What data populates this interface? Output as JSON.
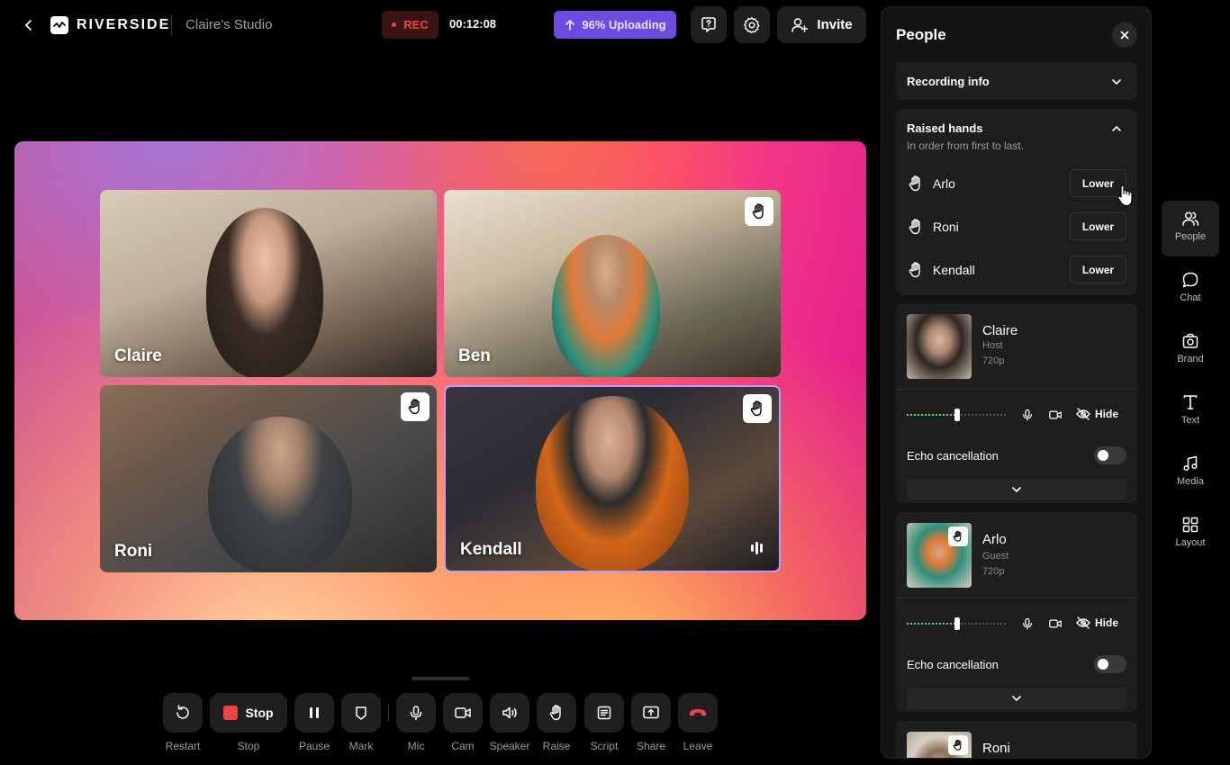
{
  "header": {
    "brand": "RIVERSIDE",
    "studio_name": "Claire’s Studio",
    "rec_label": "REC",
    "timer": "00:12:08",
    "upload_label": "96% Uploading",
    "invite_label": "Invite"
  },
  "stage": {
    "tiles": [
      {
        "name": "Claire",
        "hand_raised": false
      },
      {
        "name": "Ben",
        "hand_raised": true
      },
      {
        "name": "Roni",
        "hand_raised": true
      },
      {
        "name": "Kendall",
        "hand_raised": true,
        "speaking": true
      }
    ]
  },
  "toolbar": {
    "items": [
      {
        "label": "Restart",
        "icon": "restart-icon"
      },
      {
        "label": "Stop",
        "button_text": "Stop",
        "icon": "stop-icon"
      },
      {
        "label": "Pause",
        "icon": "pause-icon"
      },
      {
        "label": "Mark",
        "icon": "mark-icon"
      },
      {
        "label": "Mic",
        "icon": "mic-icon"
      },
      {
        "label": "Cam",
        "icon": "camera-icon"
      },
      {
        "label": "Speaker",
        "icon": "speaker-icon"
      },
      {
        "label": "Raise",
        "icon": "raise-hand-icon"
      },
      {
        "label": "Script",
        "icon": "script-icon"
      },
      {
        "label": "Share",
        "icon": "share-screen-icon"
      },
      {
        "label": "Leave",
        "icon": "leave-call-icon"
      }
    ]
  },
  "panel": {
    "title": "People",
    "recording_info": "Recording info",
    "raised_hands": {
      "title": "Raised hands",
      "subtitle": "In order from first to last.",
      "button_label": "Lower",
      "people": [
        "Arlo",
        "Roni",
        "Kendall"
      ]
    },
    "participants": [
      {
        "name": "Claire",
        "role": "Host",
        "resolution": "720p",
        "hide_label": "Hide",
        "echo_label": "Echo cancellation",
        "echo_on": false,
        "volume": 0.5
      },
      {
        "name": "Arlo",
        "role": "Guest",
        "resolution": "720p",
        "hide_label": "Hide",
        "echo_label": "Echo cancellation",
        "echo_on": false,
        "volume": 0.5,
        "hand_raised": true
      },
      {
        "name": "Roni",
        "hand_raised": true
      }
    ]
  },
  "rail": {
    "items": [
      {
        "label": "People",
        "icon": "people-icon",
        "active": true
      },
      {
        "label": "Chat",
        "icon": "chat-icon"
      },
      {
        "label": "Brand",
        "icon": "brand-icon"
      },
      {
        "label": "Text",
        "icon": "text-icon"
      },
      {
        "label": "Media",
        "icon": "media-icon"
      },
      {
        "label": "Layout",
        "icon": "layout-icon"
      }
    ]
  },
  "colors": {
    "accent": "#6d4ae0",
    "rec": "#ef4444",
    "leave": "#ef4444"
  }
}
